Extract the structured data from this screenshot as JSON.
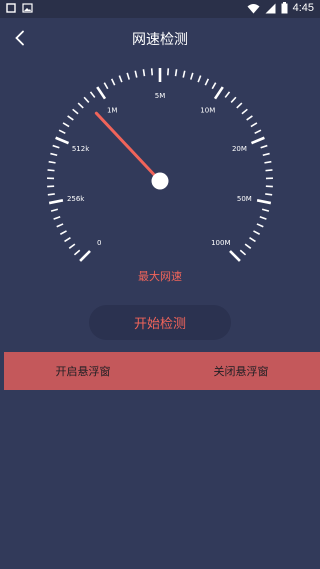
{
  "status_bar": {
    "time": "4:45",
    "left_icons": [
      "square-notification-icon",
      "image-notification-icon"
    ],
    "right_icons": [
      "wifi-icon",
      "signal-icon",
      "battery-icon"
    ]
  },
  "header": {
    "title": "网速检测",
    "back_icon": "chevron-left-icon"
  },
  "gauge": {
    "labels": [
      {
        "text": "0",
        "value_index": 0
      },
      {
        "text": "256k",
        "value_index": 1
      },
      {
        "text": "512k",
        "value_index": 2
      },
      {
        "text": "1M",
        "value_index": 3
      },
      {
        "text": "5M",
        "value_index": 4
      },
      {
        "text": "10M",
        "value_index": 5
      },
      {
        "text": "20M",
        "value_index": 6
      },
      {
        "text": "50M",
        "value_index": 7
      },
      {
        "text": "100M",
        "value_index": 8
      }
    ],
    "caption": "最大网速",
    "needle_position_fraction": 0.34
  },
  "actions": {
    "start_label": "开始检测",
    "open_float_label": "开启悬浮窗",
    "close_float_label": "关闭悬浮窗"
  },
  "colors": {
    "background": "#323a5a",
    "accent": "#f0645a",
    "float_bar": "#c4585b",
    "needle": "#f0645a"
  }
}
